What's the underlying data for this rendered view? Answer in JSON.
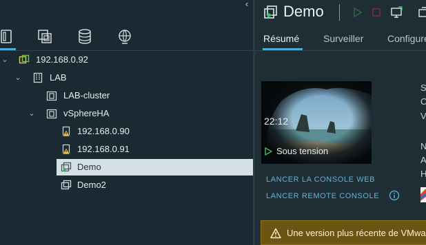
{
  "left_panel": {
    "collapse_glyph": "‹",
    "nav_icons": [
      "hosts-clusters-icon",
      "vms-templates-icon",
      "storage-icon",
      "network-icon"
    ],
    "tree": [
      {
        "label": "192.168.0.92",
        "icon": "vcenter-icon",
        "expanded": true
      },
      {
        "label": "LAB",
        "icon": "datacenter-icon",
        "expanded": true
      },
      {
        "label": "LAB-cluster",
        "icon": "cluster-icon"
      },
      {
        "label": "vSphereHA",
        "icon": "cluster-icon",
        "expanded": true
      },
      {
        "label": "192.168.0.90",
        "icon": "host-warning-icon"
      },
      {
        "label": "192.168.0.91",
        "icon": "host-warning-icon"
      },
      {
        "label": "Demo",
        "icon": "vm-powered-on-icon",
        "selected": true
      },
      {
        "label": "Demo2",
        "icon": "vm-icon"
      }
    ]
  },
  "right_panel": {
    "title": "Demo",
    "actions": [
      "power-on-icon",
      "power-off-icon",
      "console-icon",
      "migrate-icon"
    ],
    "tabs": [
      "Résumé",
      "Surveiller",
      "Configurer"
    ],
    "active_tab": "Résumé",
    "thumbnail": {
      "clock": "22:12",
      "date": "",
      "status": "Sous tension"
    },
    "links": {
      "web_console": "LANCER LA CONSOLE WEB",
      "remote_console": "LANCER REMOTE CONSOLE"
    },
    "side_letters": [
      "S",
      "C",
      "V",
      "N",
      "A",
      "H"
    ],
    "warning": "Une version plus récente de VMware Tools est disponible."
  },
  "colors": {
    "accent": "#49afd9",
    "link": "#5bb7e0",
    "selected_row": "#d4e0e6",
    "warning_bg": "#6b5513"
  }
}
